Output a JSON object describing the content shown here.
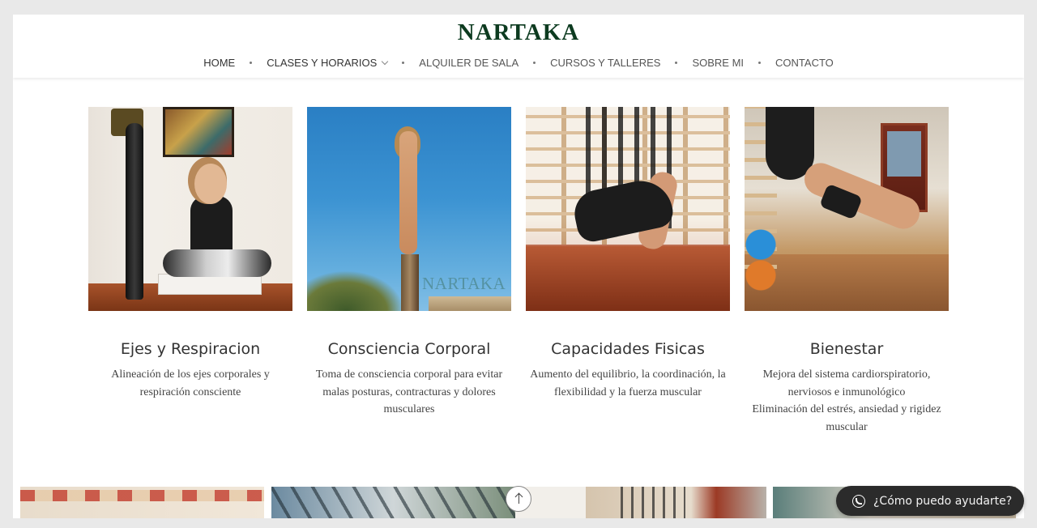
{
  "brand": {
    "logo": "NARTAKA",
    "logo_color": "#0d3b20"
  },
  "nav": {
    "items": [
      {
        "label": "HOME"
      },
      {
        "label": "CLASES Y HORARIOS",
        "has_dropdown": true
      },
      {
        "label": "ALQUILER DE SALA"
      },
      {
        "label": "CURSOS Y TALLERES"
      },
      {
        "label": "SOBRE MI"
      },
      {
        "label": "CONTACTO"
      }
    ]
  },
  "cards": [
    {
      "title": "Ejes y Respiracion",
      "description": "Alineación de los ejes corporales y respiración consciente",
      "image": "woman meditating in lotus pose"
    },
    {
      "title": "Consciencia Corporal",
      "description": "Toma de consciencia corporal para evitar malas posturas, contracturas y dolores musculares",
      "image": "woman in tree pose on wooden post at beach",
      "watermark": "NARTAKA"
    },
    {
      "title": "Capacidades Fisicas",
      "description": "Aumento del equilibrio, la coordinación, la flexibilidad y la fuerza muscular",
      "image": "aerial yoga on hammock in studio"
    },
    {
      "title": "Bienestar",
      "description_lines": [
        "Mejora del sistema cardiorspiratorio, nerviosos e inmunológico",
        "Eliminación del estrés, ansiedad y rigidez muscular"
      ],
      "image": "aerial yoga inversion in studio"
    }
  ],
  "scroll_top": {
    "icon": "arrow-up-icon"
  },
  "chat": {
    "label": "¿Cómo puedo ayudarte?",
    "icon": "whatsapp-icon",
    "background": "#2b2b2b"
  }
}
